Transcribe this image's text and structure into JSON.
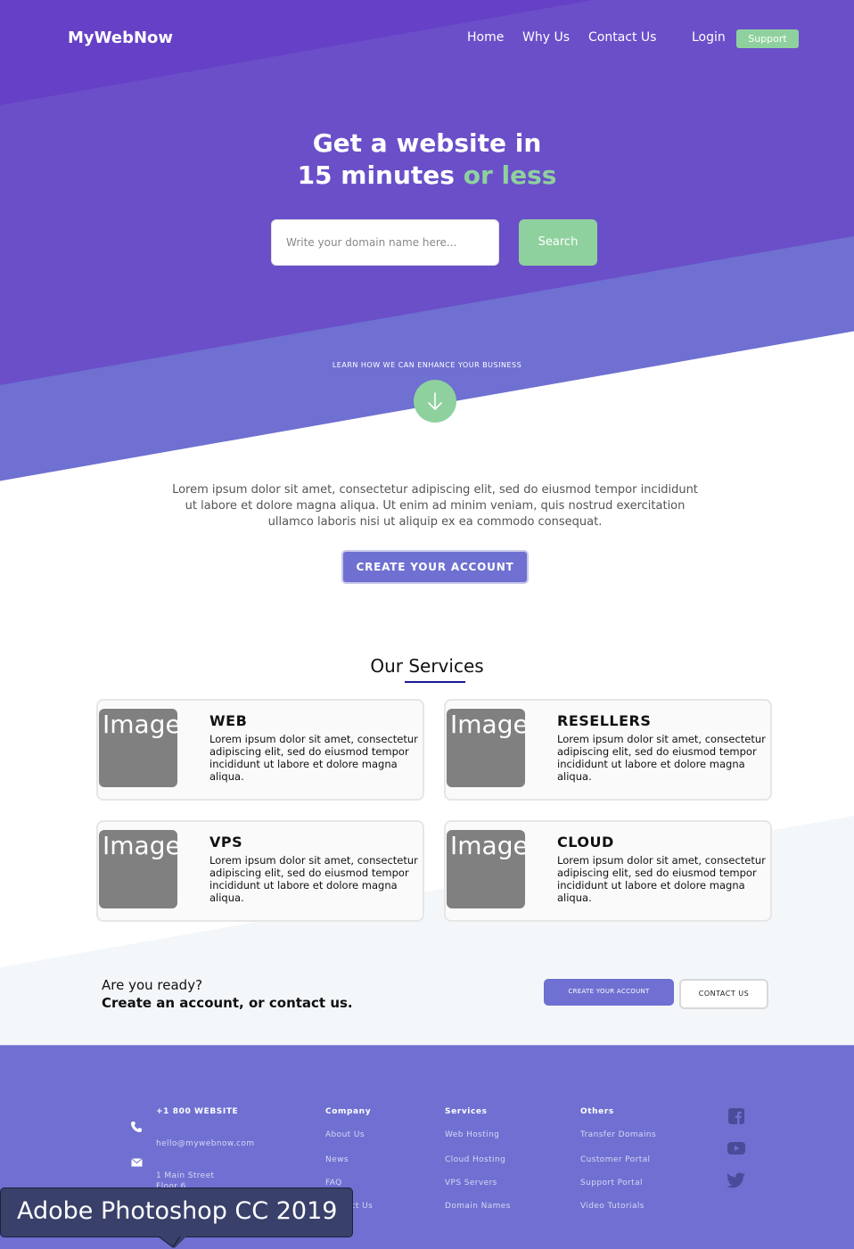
{
  "nav": {
    "logo": "MyWebNow",
    "links": [
      "Home",
      "Why Us",
      "Contact Us"
    ],
    "login": "Login",
    "support": "Support"
  },
  "hero": {
    "title_line1": "Get a website in",
    "title_line2_main": "15 minutes ",
    "title_line2_accent": "or less",
    "search_placeholder": "Write your domain name here...",
    "search_button": "Search",
    "learn_more": "LEARN HOW WE CAN ENHANCE YOUR BUSINESS"
  },
  "intro": {
    "text": "Lorem ipsum dolor sit amet, consectetur adipiscing elit, sed do eiusmod tempor incididunt ut labore et dolore magna aliqua. Ut enim ad minim veniam, quis nostrud exercitation ullamco laboris nisi ut aliquip ex ea commodo consequat.",
    "button": "CREATE YOUR ACCOUNT"
  },
  "services": {
    "title": "Our Services",
    "items": [
      {
        "image_label": "Image",
        "name": "WEB",
        "desc": "Lorem ipsum dolor sit amet, consectetur adipiscing elit, sed do eiusmod tempor incididunt ut labore et dolore magna aliqua."
      },
      {
        "image_label": "Image",
        "name": "RESELLERS",
        "desc": "Lorem ipsum dolor sit amet, consectetur adipiscing elit, sed do eiusmod tempor incididunt ut labore et dolore magna aliqua."
      },
      {
        "image_label": "Image",
        "name": "VPS",
        "desc": "Lorem ipsum dolor sit amet, consectetur adipiscing elit, sed do eiusmod tempor incididunt ut labore et dolore magna aliqua."
      },
      {
        "image_label": "Image",
        "name": "CLOUD",
        "desc": "Lorem ipsum dolor sit amet, consectetur adipiscing elit, sed do eiusmod tempor incididunt ut labore et dolore magna aliqua."
      }
    ]
  },
  "cta": {
    "question": "Are you ready?",
    "statement": "Create an account, or contact us.",
    "create_button": "CREATE YOUR ACCOUNT",
    "contact_button": "CONTACT US"
  },
  "footer": {
    "contact": {
      "phone": "+1 800 WEBSITE",
      "email": "hello@mywebnow.com",
      "address_line1": "1 Main Street",
      "address_line2": "Floor 6"
    },
    "company": {
      "heading": "Company",
      "links": [
        "About Us",
        "News",
        "FAQ",
        "Contact Us"
      ]
    },
    "services": {
      "heading": "Services",
      "links": [
        "Web Hosting",
        "Cloud Hosting",
        "VPS Servers",
        "Domain Names"
      ]
    },
    "others": {
      "heading": "Others",
      "links": [
        "Transfer Domains",
        "Customer Portal",
        "Support Portal",
        "Video Tutorials"
      ]
    },
    "social_icons": [
      "facebook-icon",
      "youtube-icon",
      "twitter-icon"
    ]
  },
  "tooltip": {
    "text": "Adobe Photoshop CC 2019"
  },
  "colors": {
    "hero_purple": "#6a4fc9",
    "hero_blue": "#6f70d1",
    "accent_green": "#8fd19e",
    "footer_bg": "#6f70d1"
  }
}
